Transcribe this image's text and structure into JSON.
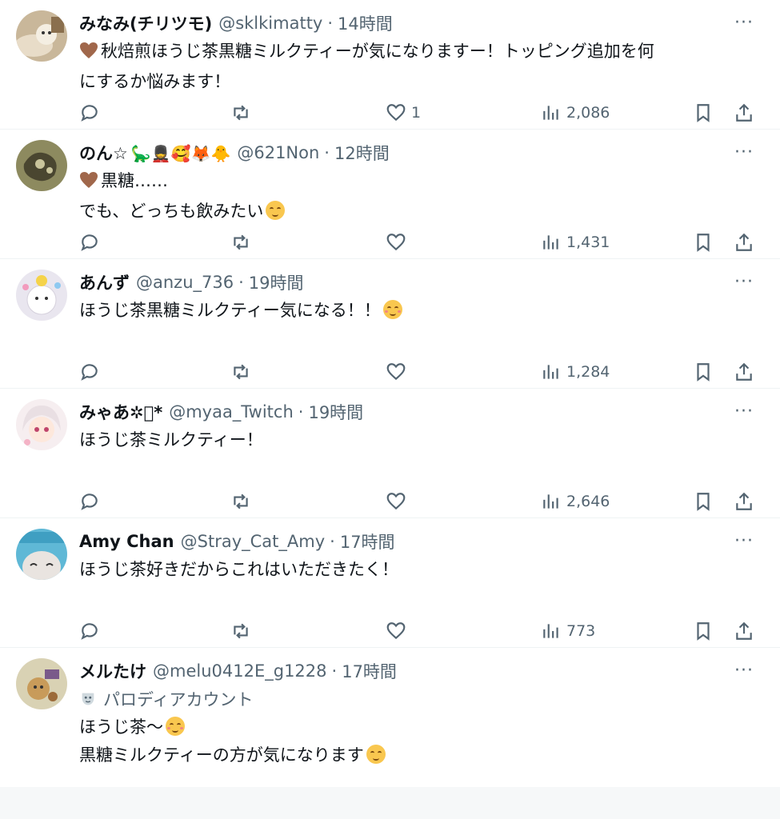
{
  "tweets": [
    {
      "name": "みなみ(チリツモ)",
      "name_emojis": "",
      "handle": "@sklkimatty",
      "time": "14時間",
      "lines": [
        "秋焙煎ほうじ茶黒糖ミルクティーが気になりますー！トッピング追加を何",
        "にするか悩みます！"
      ],
      "likes": "1",
      "views": "2,086"
    },
    {
      "name": "のん☆",
      "name_emojis": "🦕💂🥰🦊🐥",
      "handle": "@621Non",
      "time": "12時間",
      "lines": [
        "黒糖……",
        "でも、どっちも飲みたい"
      ],
      "likes": "",
      "views": "1,431"
    },
    {
      "name": "あんず",
      "name_emojis": "",
      "handle": "@anzu_736",
      "time": "19時間",
      "lines": [
        "ほうじ茶黒糖ミルクティー気になる！！"
      ],
      "likes": "",
      "views": "1,284"
    },
    {
      "name": "みゃあ✲ﾟ*",
      "name_emojis": "",
      "handle": "@myaa_Twitch",
      "time": "19時間",
      "lines": [
        "ほうじ茶ミルクティー！"
      ],
      "likes": "",
      "views": "2,646"
    },
    {
      "name": "Amy Chan",
      "name_emojis": "",
      "handle": "@Stray_Cat_Amy",
      "time": "17時間",
      "lines": [
        "ほうじ茶好きだからこれはいただきたく！"
      ],
      "likes": "",
      "views": "773"
    },
    {
      "name": "メルたけ",
      "name_emojis": "",
      "handle": "@melu0412E_g1228",
      "time": "17時間",
      "badge": "パロディアカウント",
      "lines": [
        "ほうじ茶〜",
        "黒糖ミルクティーの方が気になります"
      ]
    }
  ],
  "colors": {
    "text": "#0f1419",
    "secondary": "#536471",
    "border": "#eff3f4"
  },
  "icons": [
    "reply-icon",
    "retweet-icon",
    "like-icon",
    "views-icon",
    "bookmark-icon",
    "share-icon",
    "more-icon",
    "parody-mask-icon"
  ]
}
